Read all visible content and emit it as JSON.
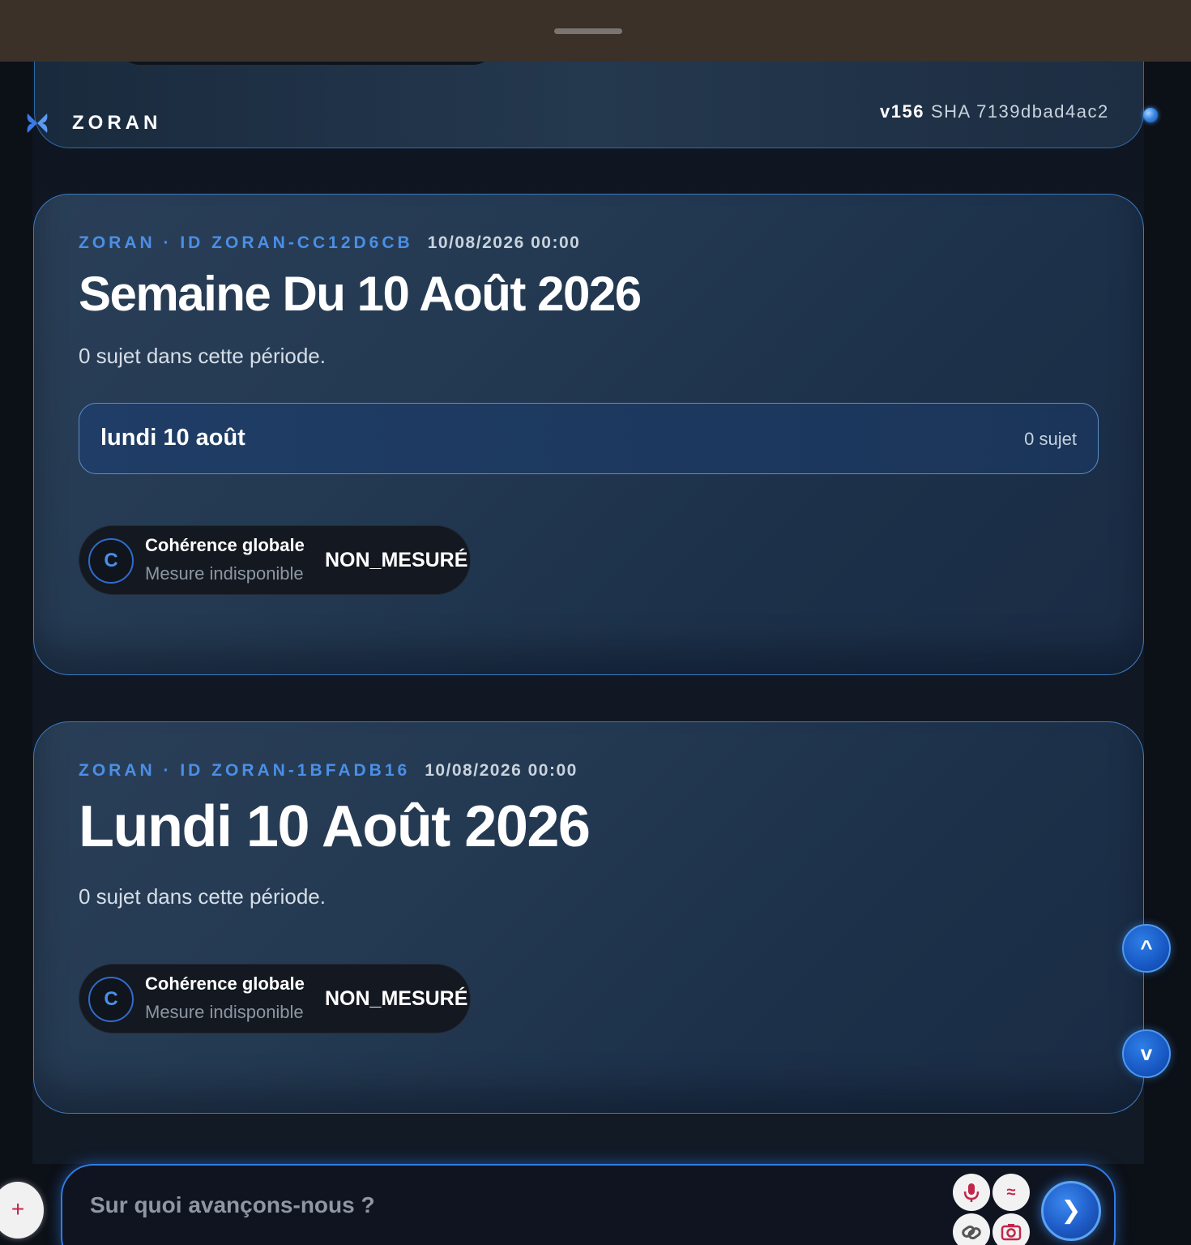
{
  "header": {
    "brand": "ZORAN",
    "version": "v156",
    "sha": "SHA 7139dbad4ac2"
  },
  "cards": [
    {
      "meta_id": "ZORAN · ID ZORAN-CC12D6CB",
      "date": "10/08/2026 00:00",
      "title": "Semaine Du 10 Août 2026",
      "subtitle": "0 sujet dans cette période.",
      "day_row": {
        "label": "lundi 10 août",
        "count": "0 sujet"
      },
      "coherence": {
        "badge": "C",
        "title": "Cohérence globale",
        "subtitle": "Mesure indisponible",
        "status": "NON_MESURÉ"
      }
    },
    {
      "meta_id": "ZORAN · ID ZORAN-1BFADB16",
      "date": "10/08/2026 00:00",
      "title": "Lundi 10 Août 2026",
      "subtitle": "0 sujet dans cette période.",
      "coherence": {
        "badge": "C",
        "title": "Cohérence globale",
        "subtitle": "Mesure indisponible",
        "status": "NON_MESURÉ"
      }
    }
  ],
  "scroll": {
    "up": "^",
    "down": "v"
  },
  "composer": {
    "placeholder": "Sur quoi avançons-nous ?",
    "plus": "+",
    "send": "❯",
    "icons": [
      "microphone-icon",
      "wave-icon",
      "link-icon",
      "camera-icon"
    ]
  },
  "colors": {
    "accent": "#4a8fe8",
    "card_border": "#3a7bc0",
    "top_bar": "#3b3128",
    "composer_icon": "#c2274b"
  }
}
